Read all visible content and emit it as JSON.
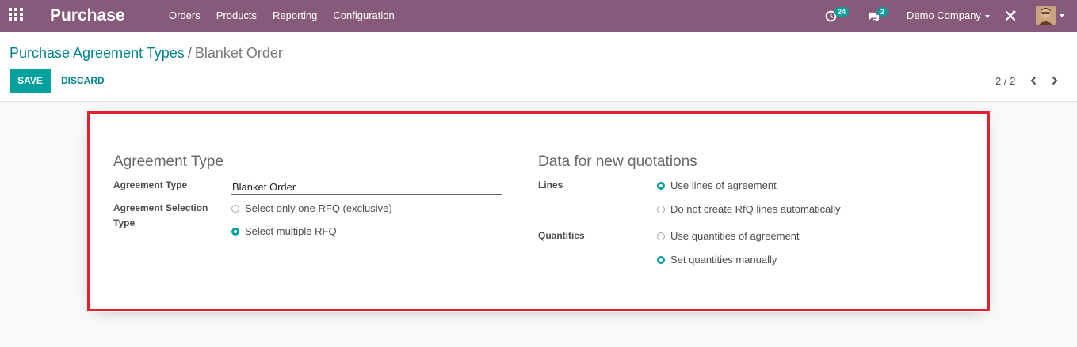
{
  "navbar": {
    "app_title": "Purchase",
    "menu": [
      "Orders",
      "Products",
      "Reporting",
      "Configuration"
    ],
    "activity_count": "24",
    "message_count": "2",
    "company": "Demo Company"
  },
  "breadcrumb": {
    "parent": "Purchase Agreement Types",
    "separator": "/",
    "current": "Blanket Order"
  },
  "buttons": {
    "save": "SAVE",
    "discard": "DISCARD"
  },
  "pager": {
    "value": "2 / 2"
  },
  "form": {
    "left_title": "Agreement Type",
    "agreement_type_label": "Agreement Type",
    "agreement_type_value": "Blanket Order",
    "selection_label_line1": "Agreement Selection",
    "selection_label_line2": "Type",
    "selection_options": [
      {
        "label": "Select only one RFQ (exclusive)",
        "checked": false
      },
      {
        "label": "Select multiple RFQ",
        "checked": true
      }
    ],
    "right_title": "Data for new quotations",
    "lines_label": "Lines",
    "lines_options": [
      {
        "label": "Use lines of agreement",
        "checked": true
      },
      {
        "label": "Do not create RfQ lines automatically",
        "checked": false
      }
    ],
    "quantities_label": "Quantities",
    "quantities_options": [
      {
        "label": "Use quantities of agreement",
        "checked": false
      },
      {
        "label": "Set quantities manually",
        "checked": true
      }
    ]
  },
  "colors": {
    "navbar": "#875a7b",
    "accent": "#00a09d",
    "link": "#00828f",
    "highlight_border": "#e3202c"
  }
}
